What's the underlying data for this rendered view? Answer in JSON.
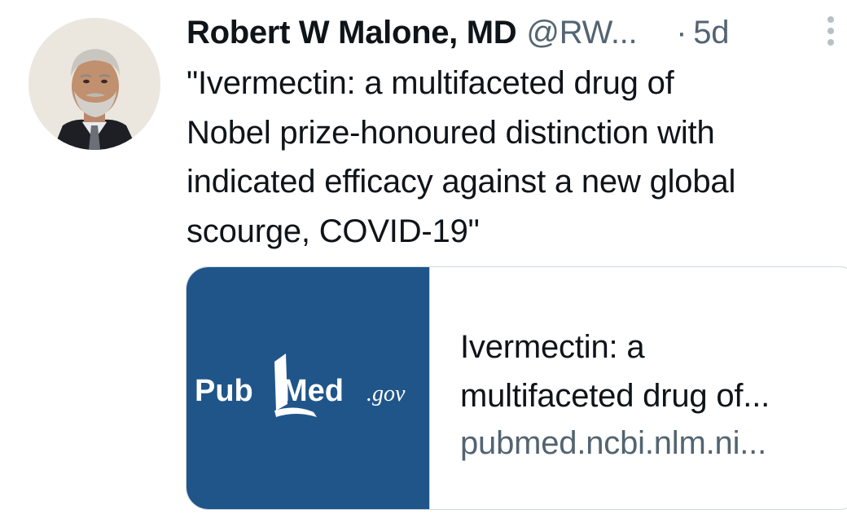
{
  "tweet": {
    "author_name": "Robert W Malone, MD",
    "handle": "@RW...",
    "separator": "·",
    "time_ago": "5d",
    "more_icon": "more-vertical-icon",
    "text_lines": [
      "\"Ivermectin: a multifaceted drug of",
      "Nobel prize-honoured distinction with",
      "indicated efficacy against a new global",
      "scourge, COVID-19\""
    ]
  },
  "link_card": {
    "thumbnail_logo": {
      "text_pub": "Pub",
      "text_med": "Med",
      "text_gov": ".gov",
      "background": "#20558a"
    },
    "title_lines": [
      "Ivermectin: a",
      "multifaceted drug of..."
    ],
    "domain": "pubmed.ncbi.nlm.ni..."
  },
  "colors": {
    "text_primary": "#0f1419",
    "text_secondary": "#536471",
    "card_border": "#cfd9de",
    "pubmed_blue": "#20558a"
  }
}
